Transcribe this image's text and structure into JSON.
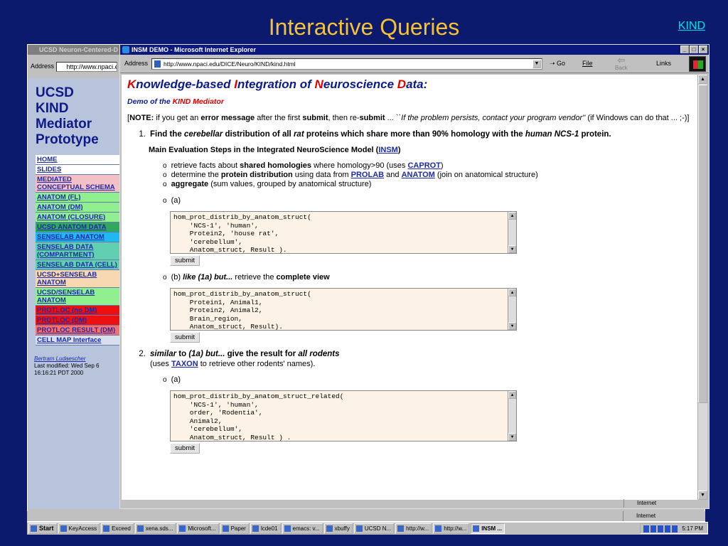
{
  "slide": {
    "title": "Interactive Queries",
    "kind_link": "KIND"
  },
  "back_window": {
    "title": "UCSD Neuron-Centered-D",
    "address_label": "Address",
    "address_value": "http://www.npaci.e",
    "status_zone": "Internet"
  },
  "nav": {
    "title_lines": [
      "UCSD",
      "KIND",
      "Mediator",
      "Prototype"
    ],
    "items": [
      {
        "label": "HOME",
        "bg": "#ffffff"
      },
      {
        "label": "SLIDES",
        "bg": "#ffffff"
      },
      {
        "label": "MEDIATED CONCEPTUAL SCHEMA",
        "bg": "#f4c0c8"
      },
      {
        "label": "ANATOM (FL)",
        "bg": "#90f090"
      },
      {
        "label": "ANATOM (DM)",
        "bg": "#90f090"
      },
      {
        "label": "ANATOM (CLOSURE)",
        "bg": "#90f090"
      },
      {
        "label": "UCSD ANATOM DATA",
        "bg": "#30a860"
      },
      {
        "label": "SENSELAB ANATOM",
        "bg": "#20b8f0"
      },
      {
        "label": "SENSELAB DATA (COMPARTMENT)",
        "bg": "#60d0b0"
      },
      {
        "label": "SENSELAB DATA (CELL)",
        "bg": "#60d0b0"
      },
      {
        "label": "UCSD+SENSELAB ANATOM",
        "bg": "#f8d8b0"
      },
      {
        "label": "UCSD/SENSELAB ANATOM",
        "bg": "#90f090"
      },
      {
        "label": "PROTLOC (no DM)",
        "bg": "#ee1010"
      },
      {
        "label": "PROTLOC (DM)",
        "bg": "#ee1010"
      },
      {
        "label": "PROTLOC RESULT (DM)",
        "bg": "#f87070"
      },
      {
        "label": "CELL MAP Interface",
        "bg": "#d8e0f0"
      }
    ],
    "author": "Bertram Ludaescher",
    "modified": "Last modified: Wed Sep 6 16:16:21 PDT 2000"
  },
  "ie": {
    "title": "INSM DEMO - Microsoft Internet Explorer",
    "address_label": "Address",
    "address_value": "http://www.npaci.edu/DICE/Neuro/KIND/kind.html",
    "go_label": "Go",
    "file_label": "File",
    "back_label": "Back",
    "links_label": "Links",
    "status_zone": "Internet"
  },
  "page": {
    "heading": [
      {
        "t": "K",
        "red": true
      },
      {
        "t": "nowledge-based ",
        "red": false
      },
      {
        "t": "I",
        "red": true
      },
      {
        "t": "ntegration of ",
        "red": false
      },
      {
        "t": "N",
        "red": true
      },
      {
        "t": "euroscience ",
        "red": false
      },
      {
        "t": "D",
        "red": true
      },
      {
        "t": "ata:",
        "red": false
      }
    ],
    "demo_prefix": "Demo of the ",
    "demo_name": "KIND Mediator",
    "note": {
      "label": "NOTE:",
      "p1": " if you get an ",
      "b1": "error message",
      "p2": " after the first ",
      "b2": "submit",
      "p3": ", then re-",
      "b3": "submit",
      "p4": " ... ",
      "i1": "``If the problem persists, contact your program vendor''",
      "p5": " (if Windows can do that ... ;-)]"
    },
    "q1": {
      "num": "1.",
      "p1": "Find the ",
      "i1": "cerebellar",
      "p2": " distribution of all ",
      "i2": "rat",
      "p3": " proteins which share more than 90% homology with the ",
      "i3": "human NCS-1",
      "p4": " protein."
    },
    "steps_title_pre": "Main Evaluation Steps in the Integrated NeuroScience Model (",
    "steps_title_link": "INSM",
    "steps_title_post": ")",
    "bullets": [
      {
        "pre": "retrieve facts about ",
        "bold": "shared homologies",
        "mid": " where homology>90 (uses ",
        "link1": "CAPROT",
        "mid2": "",
        "link2": "",
        "post": ")"
      },
      {
        "pre": "determine the ",
        "bold": "protein distribution",
        "mid": " using data from ",
        "link1": "PROLAB",
        "mid2": " and ",
        "link2": "ANATOM",
        "post": " (join on anatomical structure)"
      },
      {
        "pre": "",
        "bold": "aggregate",
        "mid": " (sum values, grouped by anatomical structure)",
        "link1": "",
        "mid2": "",
        "link2": "",
        "post": ""
      }
    ],
    "case_a": "(a)",
    "code_a": "hom_prot_distrib_by_anatom_struct(\n    'NCS-1', 'human',\n    Protein2, 'house rat',\n    'cerebellum',\n    Anatom_struct, Result ).",
    "submit_label": "submit",
    "case_b_pre": "(b) ",
    "case_b_i": "like (1a) but...",
    "case_b_mid": " retrieve the ",
    "case_b_b": "complete view",
    "code_b": "hom_prot_distrib_by_anatom_struct(\n    Protein1, Animal1,\n    Protein2, Animal2,\n    Brain_region,\n    Anatom_struct, Result).",
    "q2": {
      "num": "2.",
      "i1": "similar",
      "p1": " to ",
      "i2": "(1a) but...",
      "p2": " give the result for ",
      "i3": "all rodents",
      "sub_pre": "(uses ",
      "sub_link": "TAXON",
      "sub_post": " to retrieve other rodents' names)."
    },
    "case_c": "(a)",
    "code_c": "hom_prot_distrib_by_anatom_struct_related(\n    'NCS-1', 'human',\n    order, 'Rodentia',\n    Animal2,\n    'cerebellum',\n    Anatom_struct, Result ) ."
  },
  "taskbar": {
    "items": [
      "Start",
      "KeyAccess",
      "Exceed",
      "xena.sds...",
      "Microsoft...",
      "Paper",
      "lcde01",
      "emacs: v...",
      "xbuffy",
      "UCSD N...",
      "http://w...",
      "http://w...",
      "INSM ..."
    ],
    "active_index": 12,
    "clock": "5:17 PM"
  }
}
